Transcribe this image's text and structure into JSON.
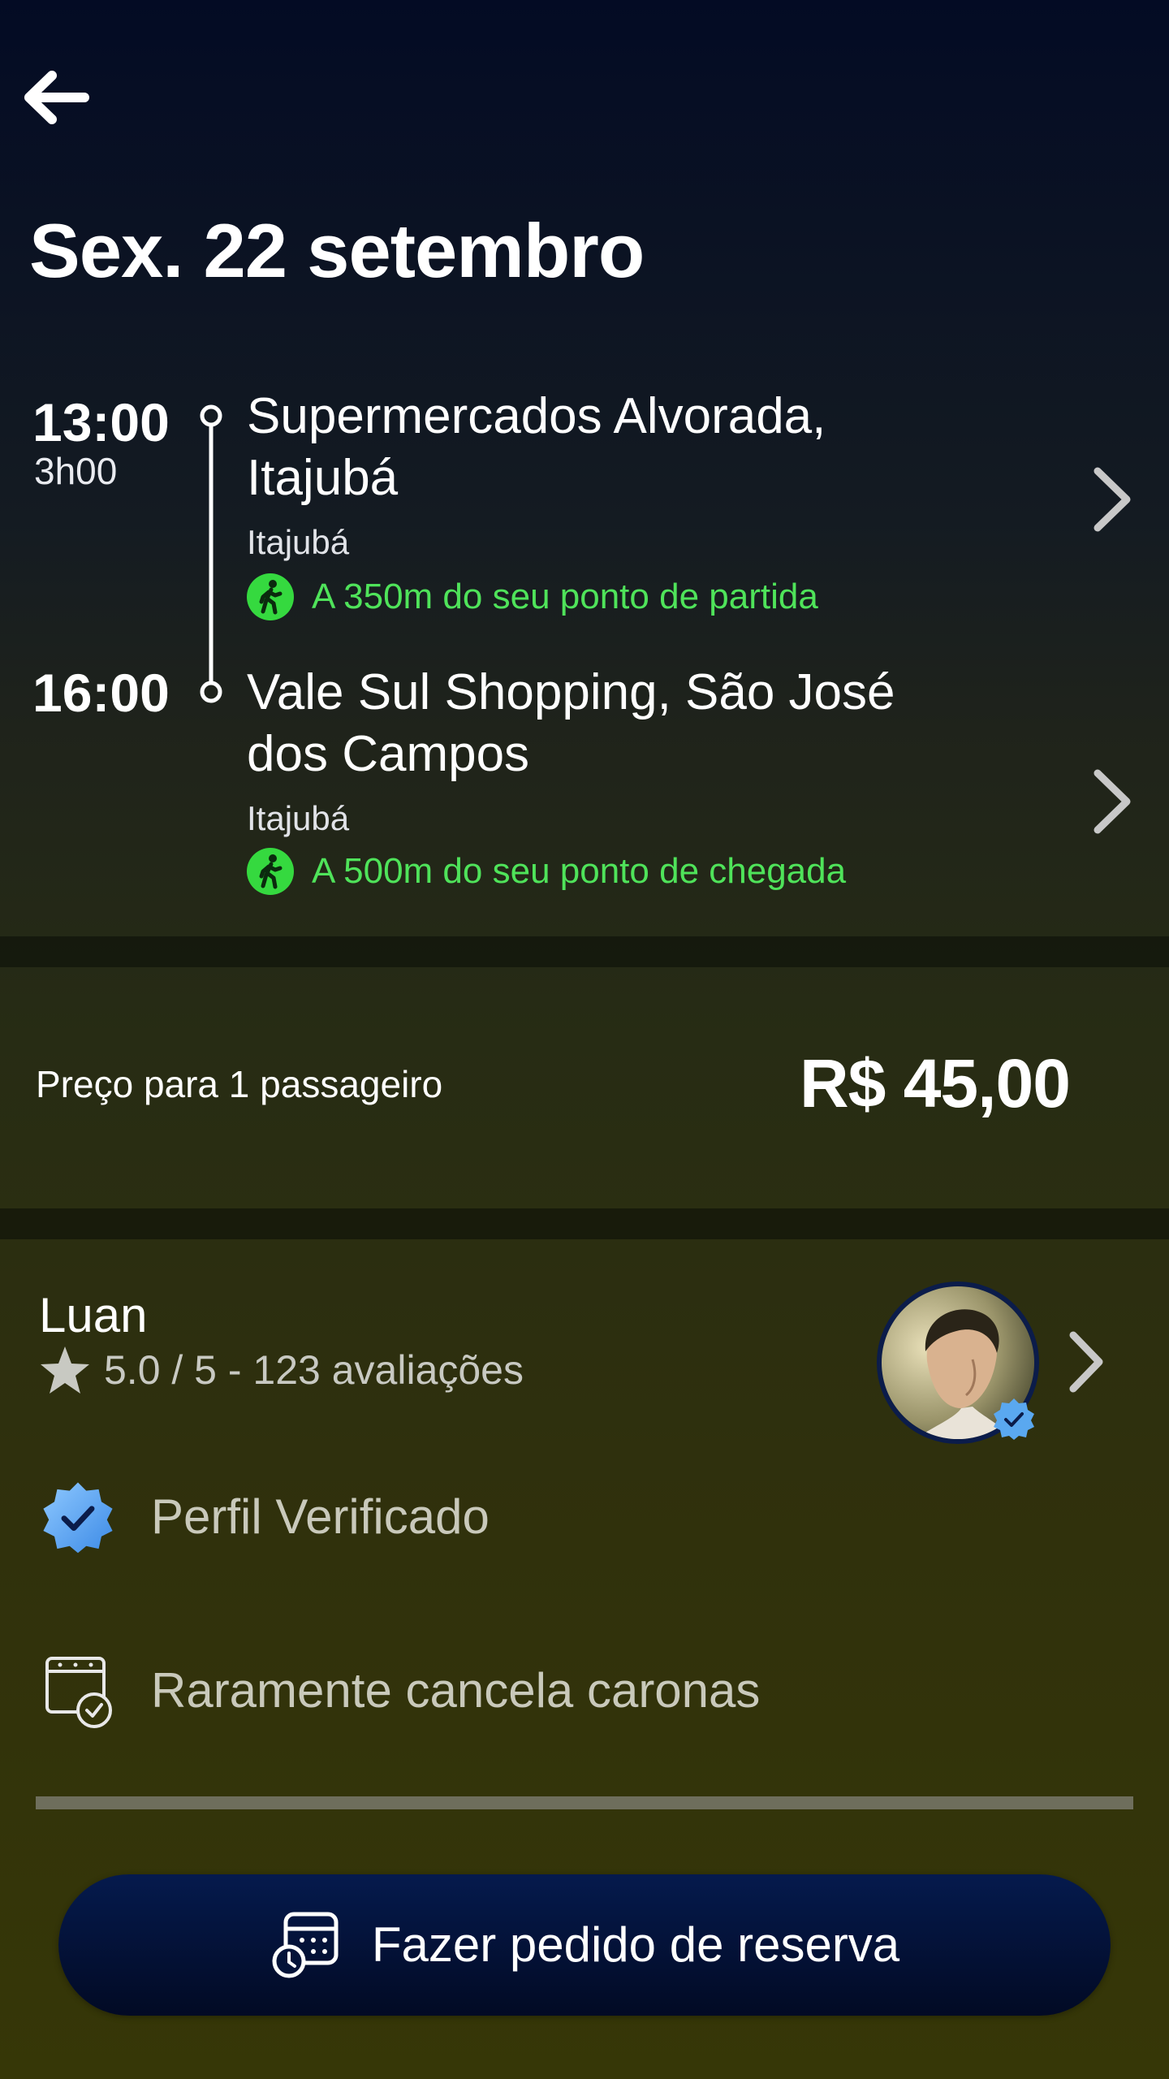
{
  "header": {
    "back_icon": "arrow-left-icon",
    "date_title": "Sex. 22 setembro"
  },
  "route": {
    "stops": [
      {
        "time": "13:00",
        "duration": "3h00",
        "title_line1": "Supermercados Alvorada,",
        "title_line2": "Itajubá",
        "city": "Itajubá",
        "walk_icon": "walking-person-icon",
        "walk_text": "A 350m do seu ponto de partida"
      },
      {
        "time": "16:00",
        "title_line1": "Vale Sul Shopping, São José",
        "title_line2": "dos Campos",
        "city": "Itajubá",
        "walk_icon": "walking-person-icon",
        "walk_text": "A 500m do seu ponto de chegada"
      }
    ]
  },
  "price": {
    "label": "Preço para 1 passageiro",
    "value": "R$ 45,00"
  },
  "driver": {
    "name": "Luan",
    "rating_text": "5.0 / 5 - 123 avaliações",
    "features": [
      {
        "icon": "verified-badge-icon",
        "label": "Perfil Verificado"
      },
      {
        "icon": "calendar-check-icon",
        "label": "Raramente cancela caronas"
      }
    ]
  },
  "cta": {
    "icon": "calendar-clock-icon",
    "label": "Fazer pedido de reserva"
  },
  "colors": {
    "walk_green": "#35d93f",
    "cta_navy": "#051a4d",
    "verified_blue": "#5aa8f0"
  }
}
